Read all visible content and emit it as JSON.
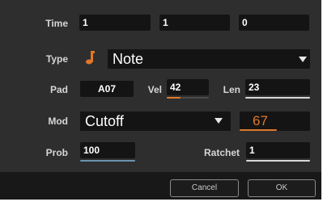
{
  "colors": {
    "accent": "#e0782a",
    "blue_underline": "#6a93b0",
    "background": "#2e2e2e",
    "field": "#141414"
  },
  "time": {
    "label": "Time",
    "values": [
      "1",
      "1",
      "0"
    ]
  },
  "type": {
    "label": "Type",
    "icon": "music-note-icon",
    "value": "Note"
  },
  "pad": {
    "label": "Pad",
    "value": "A07"
  },
  "vel": {
    "label": "Vel",
    "value": "42",
    "level": 0.33
  },
  "len": {
    "label": "Len",
    "value": "23"
  },
  "mod": {
    "label": "Mod",
    "selected": "Cutoff",
    "value": "67"
  },
  "prob": {
    "label": "Prob",
    "value": "100"
  },
  "ratchet": {
    "label": "Ratchet",
    "value": "1"
  },
  "buttons": {
    "cancel": "Cancel",
    "ok": "OK"
  }
}
